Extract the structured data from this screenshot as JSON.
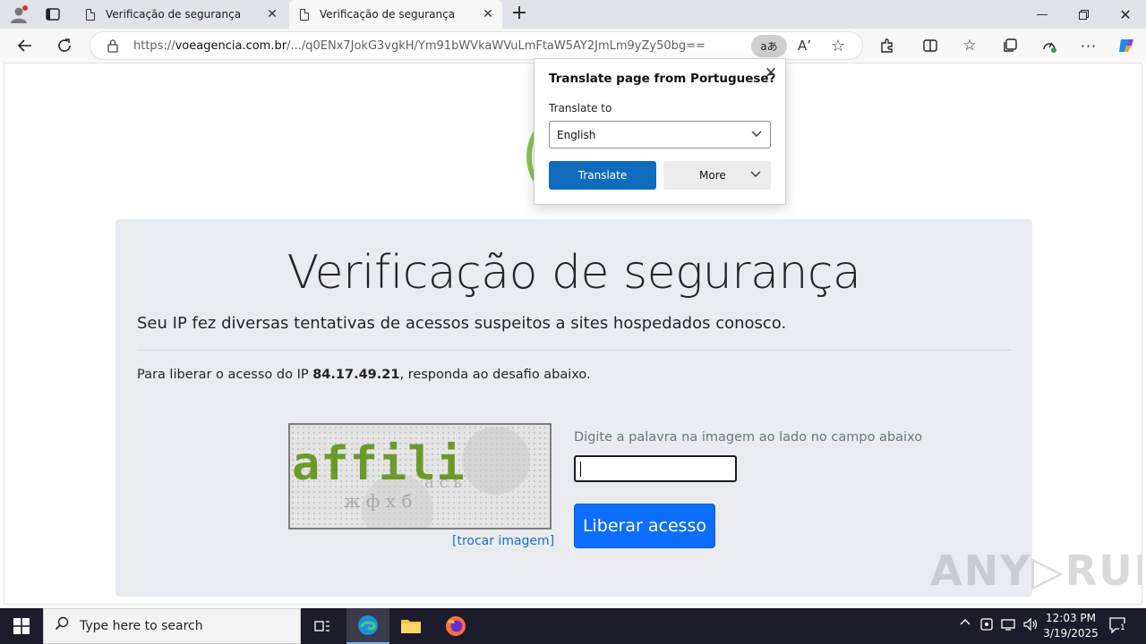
{
  "browser": {
    "tabs": [
      {
        "label": "Verificação de segurança"
      },
      {
        "label": "Verificação de segurança"
      }
    ],
    "address": {
      "prefix": "https://",
      "domain": "voeagencia.com.br",
      "path": "/.../q0ENx7JokG3vgkH/Ym91bWVkaWVuLmFtaW5AY2JmLm9yZy50bg=="
    },
    "translate_pill": "aあ",
    "read_aloud": "A’"
  },
  "translate_popup": {
    "title": "Translate page from Portuguese?",
    "label": "Translate to",
    "selected_language": "English",
    "translate_label": "Translate",
    "more_label": "More"
  },
  "page": {
    "heading": "Verificação de segurança",
    "lead": "Seu IP fez diversas tentativas de acessos suspeitos a sites hospedados conosco.",
    "ip_prefix": "Para liberar o acesso do IP ",
    "ip": "84.17.49.21",
    "ip_suffix": ", responda ao desafio abaixo.",
    "captcha_word": "affili",
    "swap_image": "[trocar imagem]",
    "hint": "Digite a palavra na imagem ao lado no campo abaixo",
    "submit_label": "Liberar acesso"
  },
  "watermark": "ANY▷RUN",
  "taskbar": {
    "search_placeholder": "Type here to search",
    "time": "12:03 PM",
    "date": "3/19/2025",
    "notifications": "1"
  },
  "colors": {
    "accent_blue": "#0d6efd",
    "edge_blue": "#0f6cbd",
    "panel_bg": "#e9ecef",
    "captcha_green": "#6b9a2a"
  }
}
